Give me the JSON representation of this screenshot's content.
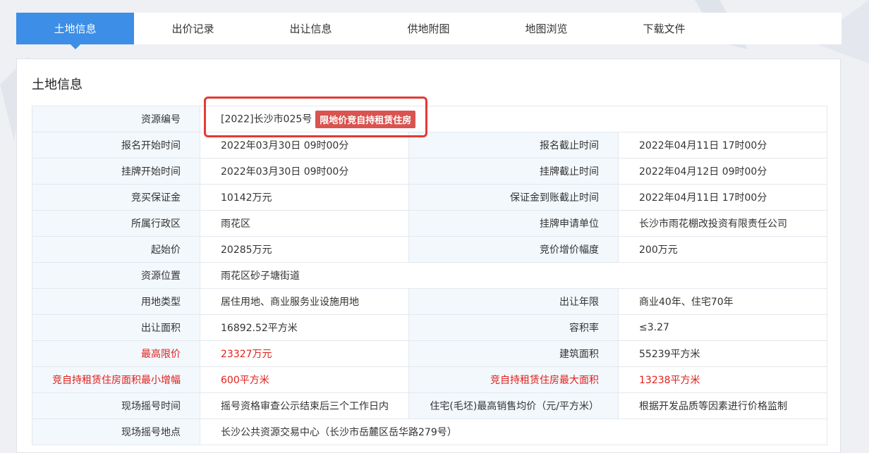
{
  "tabs": [
    {
      "label": "土地信息",
      "active": true
    },
    {
      "label": "出价记录",
      "active": false
    },
    {
      "label": "出让信息",
      "active": false
    },
    {
      "label": "供地附图",
      "active": false
    },
    {
      "label": "地图浏览",
      "active": false
    },
    {
      "label": "下载文件",
      "active": false
    }
  ],
  "panel": {
    "title": "土地信息"
  },
  "colors": {
    "accent": "#3c8ee6",
    "red": "#e0201b",
    "tag": "#d9534f",
    "highlight": "#e53935"
  },
  "rows": [
    {
      "label": "资源编号",
      "value": "[2022]长沙市025号",
      "tag": "限地价竞自持租赁住房"
    },
    {
      "label": "报名开始时间",
      "value": "2022年03月30日 09时00分",
      "label2": "报名截止时间",
      "value2": "2022年04月11日 17时00分"
    },
    {
      "label": "挂牌开始时间",
      "value": "2022年03月30日 09时00分",
      "label2": "挂牌截止时间",
      "value2": "2022年04月12日 09时00分"
    },
    {
      "label": "竞买保证金",
      "value": "10142万元",
      "label2": "保证金到账截止时间",
      "value2": "2022年04月11日 17时00分"
    },
    {
      "label": "所属行政区",
      "value": "雨花区",
      "label2": "挂牌申请单位",
      "value2": "长沙市雨花棚改投资有限责任公司"
    },
    {
      "label": "起始价",
      "value": "20285万元",
      "label2": "竞价增价幅度",
      "value2": "200万元"
    },
    {
      "label": "资源位置",
      "value": "雨花区砂子塘街道"
    },
    {
      "label": "用地类型",
      "value": "居住用地、商业服务业设施用地",
      "label2": "出让年限",
      "value2": "商业40年、住宅70年"
    },
    {
      "label": "出让面积",
      "value": "16892.52平方米",
      "label2": "容积率",
      "value2": "≤3.27"
    },
    {
      "label": "最高限价",
      "value": "23327万元",
      "label2": "建筑面积",
      "value2": "55239平方米"
    },
    {
      "label": "竞自持租赁住房面积最小增幅",
      "value": "600平方米",
      "label2": "竞自持租赁住房最大面积",
      "value2": "13238平方米"
    },
    {
      "label": "现场摇号时间",
      "value": "摇号资格审查公示结束后三个工作日内",
      "label2": "住宅(毛坯)最高销售均价（元/平方米）",
      "value2": "根据开发品质等因素进行价格监制"
    },
    {
      "label": "现场摇号地点",
      "value": "长沙公共资源交易中心（长沙市岳麓区岳华路279号）"
    }
  ]
}
